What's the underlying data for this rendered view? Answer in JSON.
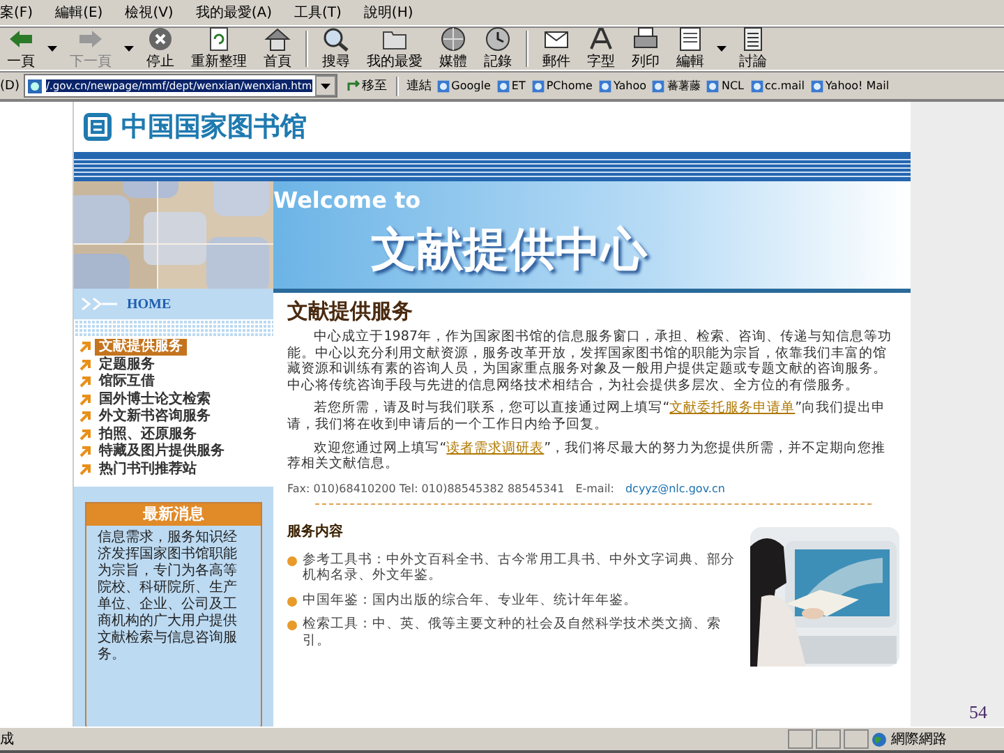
{
  "menu": [
    "案(F)",
    "編輯(E)",
    "檢視(V)",
    "我的最愛(A)",
    "工具(T)",
    "說明(H)"
  ],
  "toolbar": [
    {
      "label": "一頁",
      "menu": true
    },
    {
      "label": "下一頁",
      "menu": true,
      "disabled": true
    },
    {
      "label": "停止",
      "menu": false
    },
    {
      "label": "重新整理",
      "menu": false
    },
    {
      "label": "首頁",
      "menu": false
    },
    {
      "label": "搜尋",
      "menu": false
    },
    {
      "label": "我的最愛",
      "menu": false
    },
    {
      "label": "媒體",
      "menu": false
    },
    {
      "label": "記錄",
      "menu": false
    },
    {
      "label": "郵件",
      "menu": false
    },
    {
      "label": "字型",
      "menu": false
    },
    {
      "label": "列印",
      "menu": false
    },
    {
      "label": "編輯",
      "menu": true
    },
    {
      "label": "討論",
      "menu": false
    }
  ],
  "address": {
    "label": "(D)",
    "value": "/.gov.cn/newpage/mmf/dept/wenxian/wenxian.htm",
    "go": "移至",
    "links_label": "連結",
    "links": [
      "Google",
      "ET",
      "PChome",
      "Yahoo",
      "蕃薯藤",
      "NCL",
      "cc.mail",
      "Yahoo! Mail"
    ]
  },
  "page": {
    "logo": "中国国家图书馆",
    "welcome": "Welcome to",
    "banner_title": "文献提供中心",
    "home": "HOME",
    "nav": [
      {
        "label": "文献提供服务",
        "selected": true
      },
      {
        "label": "定题服务",
        "selected": false
      },
      {
        "label": "馆际互借",
        "selected": false
      },
      {
        "label": "国外博士论文检索",
        "selected": false
      },
      {
        "label": "外文新书咨询服务",
        "selected": false
      },
      {
        "label": "拍照、还原服务",
        "selected": false
      },
      {
        "label": "特藏及图片提供服务",
        "selected": false
      },
      {
        "label": "热门书刊推荐站",
        "selected": false
      }
    ],
    "news": {
      "title": "最新消息",
      "text": "信息需求，服务知识经济发挥国家图书馆职能为宗旨，专门为各高等院校、科研院所、生产单位、企业、公司及工商机构的广大用户提供文献检索与信息咨询服务。"
    },
    "heading": "文献提供服务",
    "paragraphs": [
      [
        {
          "kind": "text",
          "text": "中心成立于1987年，作为国家图书馆的信息服务窗口，承担、检索、咨询、传递与知信息等功能。中心以充分利用文献资源，服务改革开放，发挥国家图书馆的职能为宗旨，依靠我们丰富的馆藏资源和训练有素的咨询人员，为国家重点服务对象及一般用户提供定题或专题文献的咨询服务。中心将传统咨询手段与先进的信息网络技术相结合，为社会提供多层次、全方位的有偿服务。"
        }
      ],
      [
        {
          "kind": "text",
          "text": "若您所需，请及时与我们联系，您可以直接通过网上填写“"
        },
        {
          "kind": "link",
          "text": "文献委托服务申请单"
        },
        {
          "kind": "text",
          "text": "”向我们提出申请，我们将在收到申请后的一个工作日内给予回复。"
        }
      ],
      [
        {
          "kind": "text",
          "text": "欢迎您通过网上填写“"
        },
        {
          "kind": "link",
          "text": "读者需求调研表"
        },
        {
          "kind": "text",
          "text": "”，我们将尽最大的努力为您提供所需，并不定期向您推荐相关文献信息。"
        }
      ]
    ],
    "contact": "Fax: 010)68410200 Tel: 010)88545382 88545341",
    "email_label": "E-mail:",
    "email": "dcyyz@nlc.gov.cn",
    "services_title": "服务内容",
    "services": [
      "参考工具书：中外文百科全书、古今常用工具书、中外文字词典、部分机构名录、外文年鉴。",
      "中国年鉴：国内出版的综合年、专业年、统计年年鉴。",
      "检索工具：中、英、俄等主要文种的社会及自然科学技术类文摘、索引。"
    ]
  },
  "page_number": "54",
  "status_bar": {
    "text": "成",
    "zone": "網際網路"
  }
}
